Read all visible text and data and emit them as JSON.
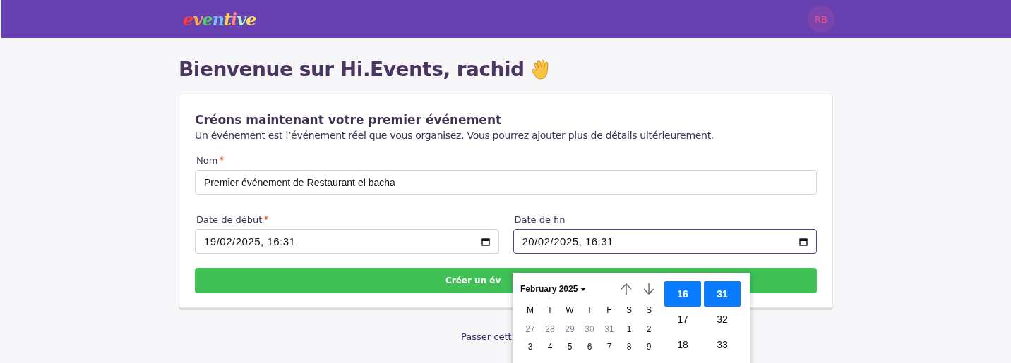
{
  "header": {
    "logo": "eventive",
    "avatar": "RB"
  },
  "heading": "Bienvenue sur Hi.Events, rachid",
  "card": {
    "title": "Créons maintenant votre premier événement",
    "subtitle": "Un événement est l’événement réel que vous organisez. Vous pourrez ajouter plus de détails ultérieurement.",
    "name_field": {
      "label": "Nom",
      "required": true,
      "value": "Premier événement de Restaurant el bacha",
      "focused": false
    },
    "date_fields": [
      {
        "label": "Date de début",
        "required": true,
        "value": "19/02/2025, 16:31",
        "focused": false
      },
      {
        "label": "Date de fin",
        "required": false,
        "value": "20/02/2025, 16:31",
        "focused": true
      }
    ],
    "submit_button": "Créer un év"
  },
  "skip_link": "Passer cett",
  "date_picker": {
    "month": "February 2025",
    "weekdays": [
      "M",
      "T",
      "W",
      "T",
      "F",
      "S",
      "S"
    ],
    "weeks": [
      [
        {
          "day": "27",
          "outside": true
        },
        {
          "day": "28",
          "outside": true
        },
        {
          "day": "29",
          "outside": true
        },
        {
          "day": "30",
          "outside": true
        },
        {
          "day": "31",
          "outside": true
        },
        {
          "day": "1",
          "outside": false
        },
        {
          "day": "2",
          "outside": false
        }
      ],
      [
        {
          "day": "3",
          "outside": false
        },
        {
          "day": "4",
          "outside": false
        },
        {
          "day": "5",
          "outside": false
        },
        {
          "day": "6",
          "outside": false
        },
        {
          "day": "7",
          "outside": false
        },
        {
          "day": "8",
          "outside": false
        },
        {
          "day": "9",
          "outside": false
        }
      ]
    ],
    "hours": [
      {
        "label": "16",
        "selected": true
      },
      {
        "label": "17",
        "selected": false
      },
      {
        "label": "18",
        "selected": false
      }
    ],
    "minutes": [
      {
        "label": "31",
        "selected": true
      },
      {
        "label": "32",
        "selected": false
      },
      {
        "label": "33",
        "selected": false
      }
    ]
  }
}
